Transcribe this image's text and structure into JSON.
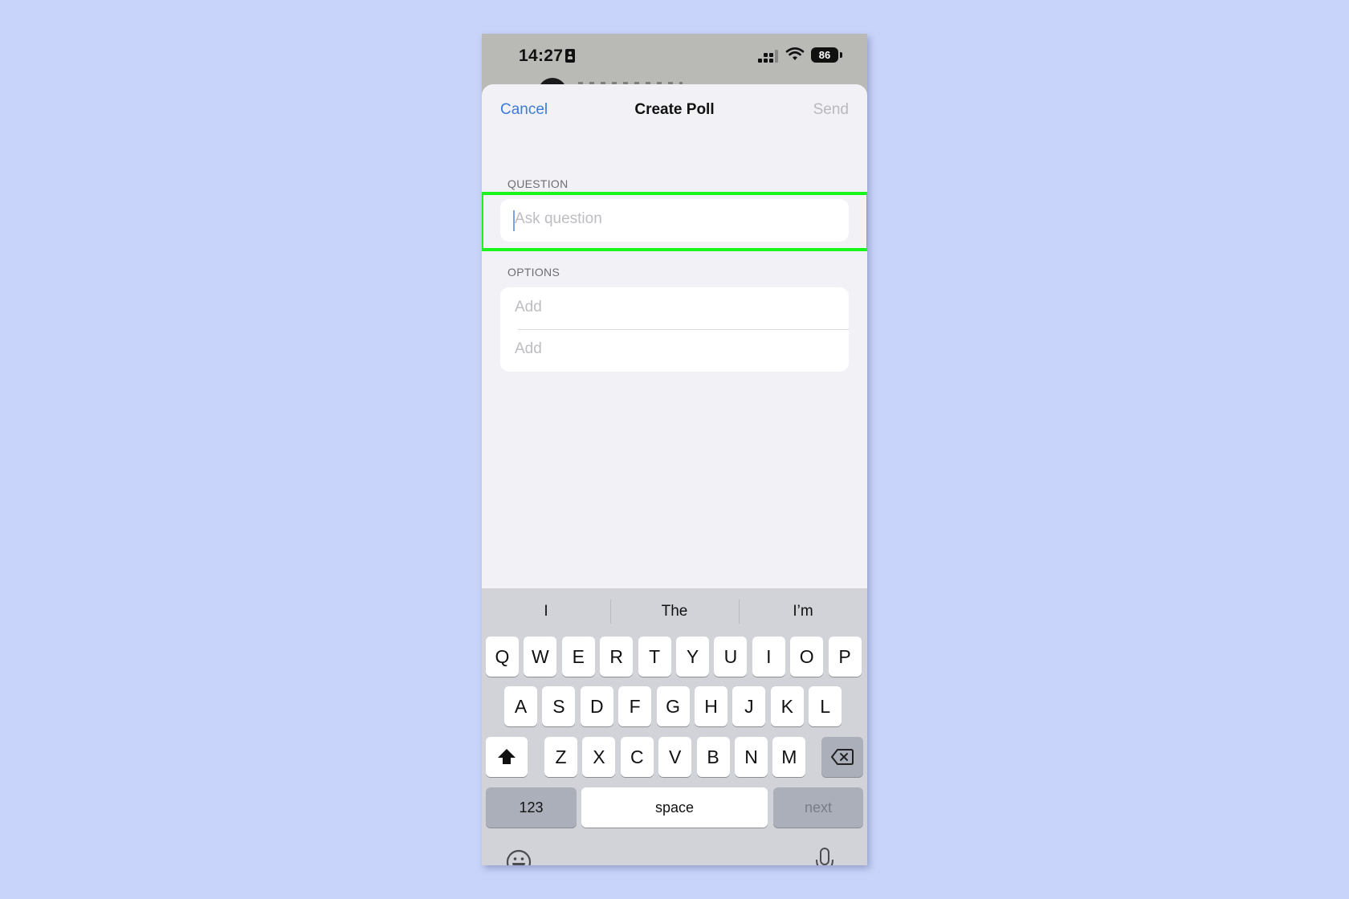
{
  "status_bar": {
    "time": "14:27",
    "battery": "86",
    "icons": [
      "id-card-icon",
      "cellular-signal-icon",
      "wifi-icon",
      "battery-icon"
    ]
  },
  "nav": {
    "cancel_label": "Cancel",
    "title": "Create Poll",
    "send_label": "Send"
  },
  "question": {
    "section_label": "QUESTION",
    "value": "",
    "placeholder": "Ask question"
  },
  "options": {
    "section_label": "OPTIONS",
    "items": [
      {
        "value": "",
        "placeholder": "Add"
      },
      {
        "value": "",
        "placeholder": "Add"
      }
    ]
  },
  "keyboard": {
    "suggestions": [
      "I",
      "The",
      "I’m"
    ],
    "row1": [
      "Q",
      "W",
      "E",
      "R",
      "T",
      "Y",
      "U",
      "I",
      "O",
      "P"
    ],
    "row2": [
      "A",
      "S",
      "D",
      "F",
      "G",
      "H",
      "J",
      "K",
      "L"
    ],
    "row3": [
      "Z",
      "X",
      "C",
      "V",
      "B",
      "N",
      "M"
    ],
    "numbers_label": "123",
    "space_label": "space",
    "return_label": "next",
    "icons": [
      "shift-icon",
      "delete-icon",
      "emoji-icon",
      "microphone-icon"
    ]
  },
  "colors": {
    "accent": "#3d7bd8",
    "highlight": "#19f519",
    "background": "#c9d4fa"
  }
}
